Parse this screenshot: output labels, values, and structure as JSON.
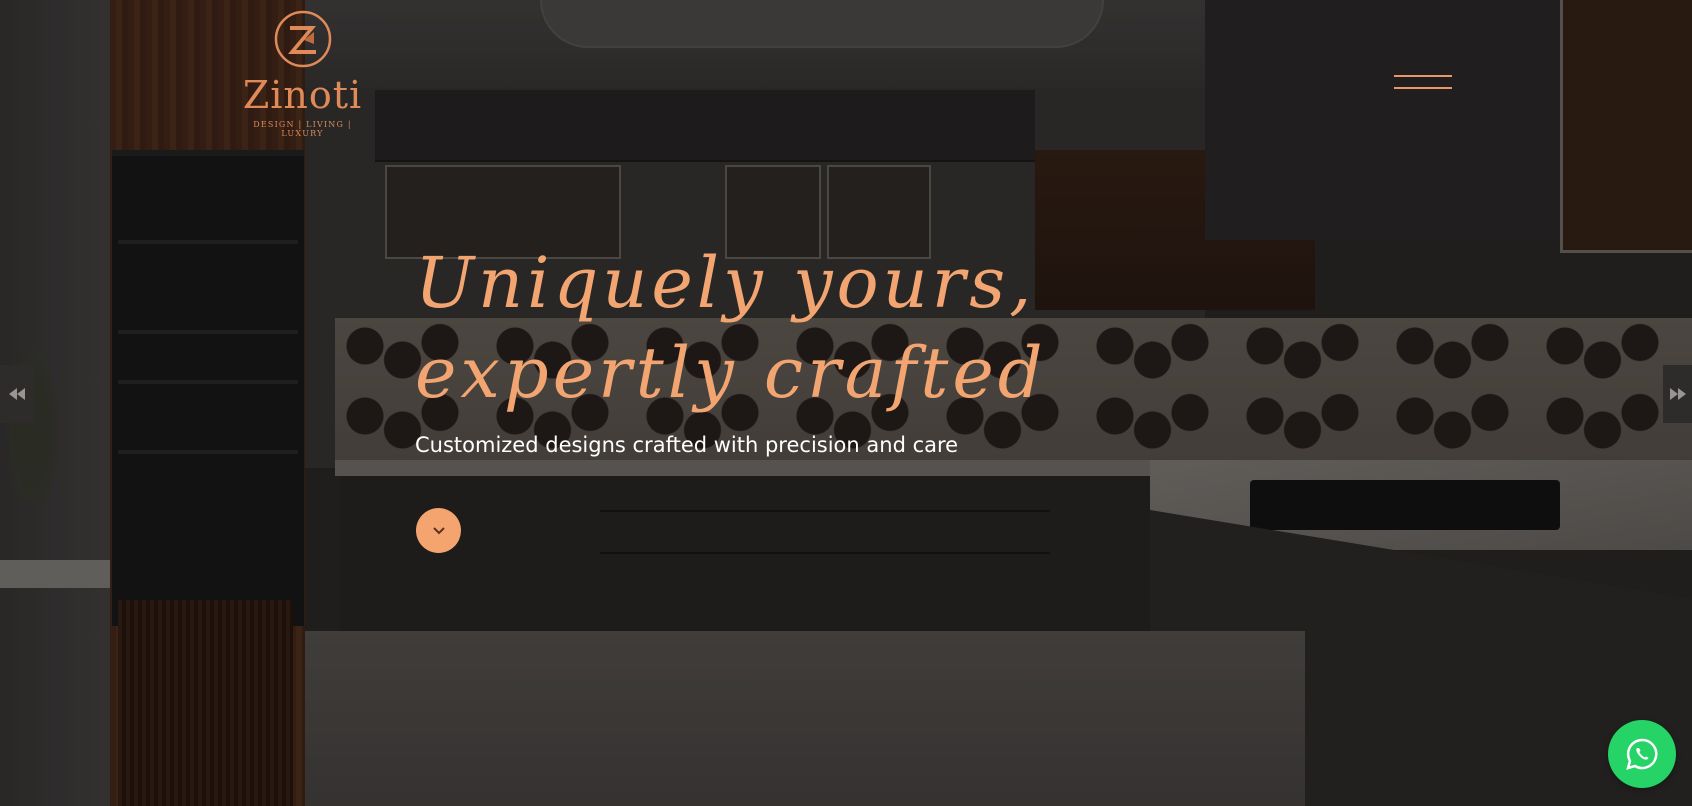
{
  "brand": {
    "name": "Zinoti",
    "tagline": "DESIGN | LIVING | LUXURY",
    "logo_icon": "z-monogram-icon",
    "accent_color": "#f2a571"
  },
  "nav": {
    "menu_icon": "hamburger-menu-icon"
  },
  "hero": {
    "headline": "Uniquely yours, expertly crafted",
    "subheadline": "Customized designs crafted with precision and care",
    "scroll_icon": "chevron-down-icon",
    "background_image": "kitchen-interior-photo"
  },
  "slider": {
    "prev_icon": "double-chevron-left-icon",
    "next_icon": "double-chevron-right-icon"
  },
  "whatsapp": {
    "icon": "whatsapp-icon",
    "color": "#25d366"
  }
}
